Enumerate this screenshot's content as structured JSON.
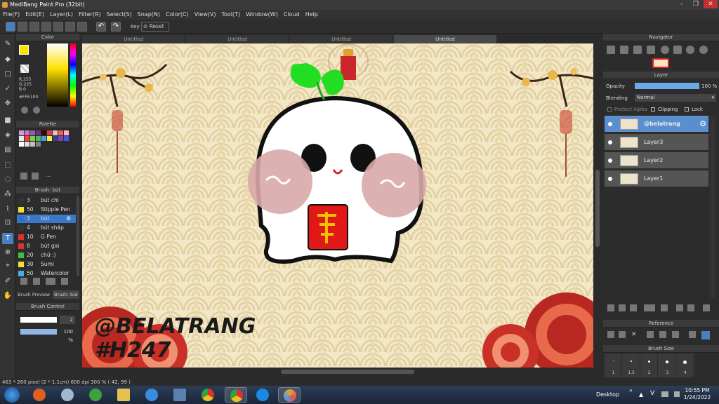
{
  "window": {
    "title": "MediBang Paint Pro (32bit)"
  },
  "menu": [
    "File(F)",
    "Edit(E)",
    "Layer(L)",
    "Filter(R)",
    "Select(S)",
    "Snap(N)",
    "Color(C)",
    "View(V)",
    "Tool(T)",
    "Window(W)",
    "Cloud",
    "Help"
  ],
  "toolbar": {
    "key_label": "Key",
    "reset_label": "Reset"
  },
  "color_panel": {
    "title": "Color",
    "r": "R:255",
    "g": "G:225",
    "b": "B:0",
    "hex": "#FFE100"
  },
  "palette_panel": {
    "title": "Palette",
    "colors": [
      "#c9a0d0",
      "#d070c0",
      "#9060b0",
      "#703080",
      "#400000",
      "#d04040",
      "#f0c0c0",
      "#f06060",
      "#f8b8c8",
      "#e8e8f8",
      "#f04040",
      "#80d040",
      "#40c060",
      "#40a0e0",
      "#f0f040",
      "#404080",
      "#8040c0",
      "#5050e0",
      "#ffffff",
      "#e0e0e0",
      "#c0c0c0",
      "#808080"
    ],
    "more_label": "..."
  },
  "brush_panel": {
    "title": "Brush: bút",
    "brushes": [
      {
        "color": "#333333",
        "size": "3",
        "name": "bút chì"
      },
      {
        "color": "#f0e030",
        "size": "50",
        "name": "Stipple Pen"
      },
      {
        "color": "#3070c0",
        "size": "3",
        "name": "bút"
      },
      {
        "color": "#333333",
        "size": "4",
        "name": "bút sháp"
      },
      {
        "color": "#e03030",
        "size": "10",
        "name": "G Pen"
      },
      {
        "color": "#e03030",
        "size": "8",
        "name": "bút gai"
      },
      {
        "color": "#40c040",
        "size": "20",
        "name": "chữ :)"
      },
      {
        "color": "#f0e030",
        "size": "30",
        "name": "Sumi"
      },
      {
        "color": "#40b0e0",
        "size": "50",
        "name": "Watercolor"
      }
    ],
    "tabs": [
      "Brush Preview",
      "Brush: bút"
    ]
  },
  "brush_control": {
    "title": "Brush Control",
    "size": "2",
    "opacity": "100 %"
  },
  "tabs": [
    "Untitled",
    "Untitled",
    "Untitled",
    "Untitled"
  ],
  "canvas": {
    "watermark_line1": "@BELATRANG",
    "watermark_line2": "#H247"
  },
  "status": {
    "text": "463 * 260 pixel   (2 * 1.1cm)   600 dpi   300 %   ( 42, 99 )"
  },
  "navigator": {
    "title": "Navigator"
  },
  "layer_panel": {
    "title": "Layer",
    "opacity_label": "Opacity",
    "opacity_value": "100 %",
    "opacity_fraction": 1.0,
    "blending_label": "Blending",
    "blending_value": "Normal",
    "protect_alpha": "Protect Alpha",
    "clipping": "Clipping",
    "lock": "Lock",
    "layers": [
      {
        "name": "@belatrang",
        "selected": true
      },
      {
        "name": "Layer3",
        "selected": false
      },
      {
        "name": "Layer2",
        "selected": false
      },
      {
        "name": "Layer1",
        "selected": false
      }
    ]
  },
  "reference": {
    "title": "Reference"
  },
  "brush_size_panel": {
    "title": "Brush Size",
    "sizes": [
      "1",
      "1.5",
      "2",
      "3",
      "4"
    ]
  },
  "taskbar": {
    "desktop_label": "Desktop",
    "time": "10:55 PM",
    "date": "1/24/2022"
  }
}
